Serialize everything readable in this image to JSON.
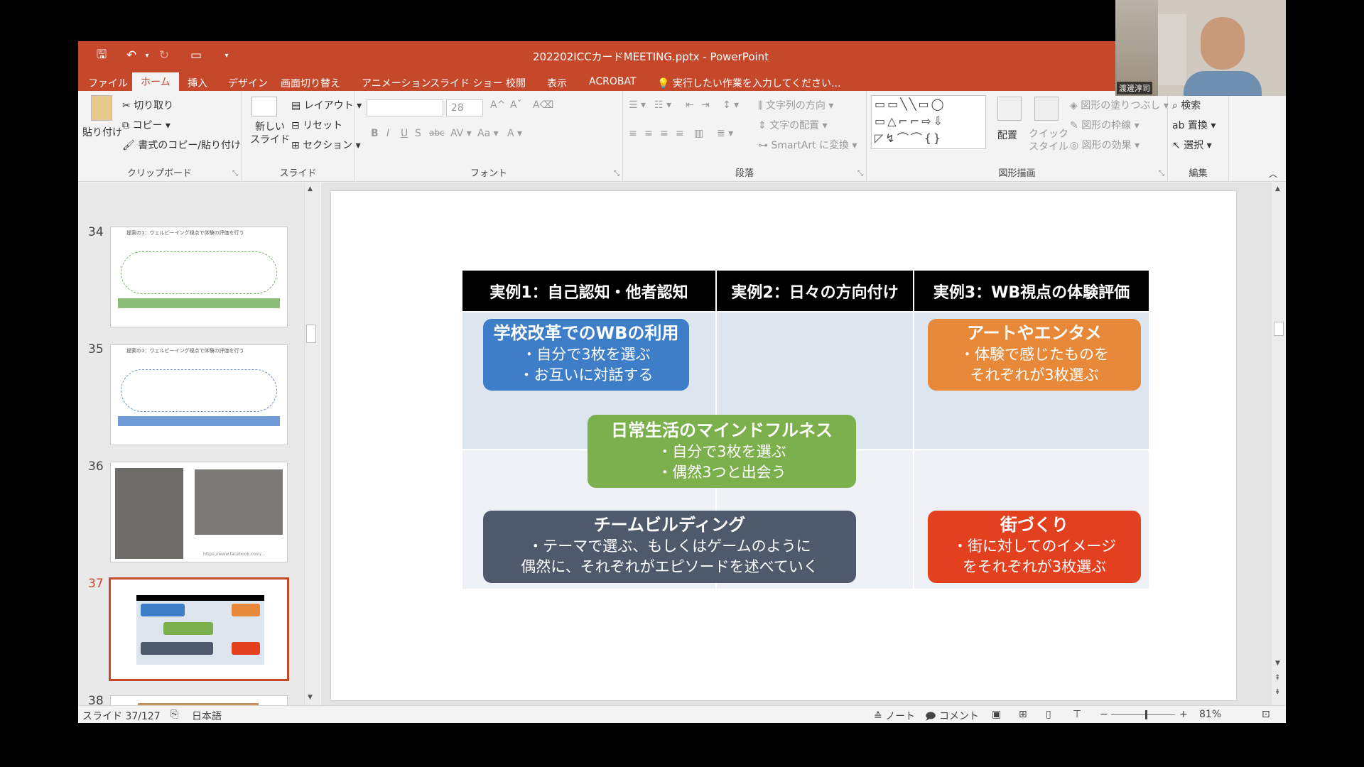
{
  "window": {
    "title": "202202ICCカードMEETING.pptx - PowerPoint"
  },
  "tabs": [
    "ファイル",
    "ホーム",
    "挿入",
    "デザイン",
    "画面切り替え",
    "アニメーション",
    "スライド ショー",
    "校閲",
    "表示",
    "ACROBAT"
  ],
  "tell_me": "実行したい作業を入力してください...",
  "ribbon": {
    "clipboard": {
      "paste": "貼り付け",
      "cut": "切り取り",
      "copy": "コピー",
      "format_painter": "書式のコピー/貼り付け",
      "label": "クリップボード"
    },
    "slides": {
      "new_slide": "新しい\nスライド",
      "layout": "レイアウト",
      "reset": "リセット",
      "section": "セクション",
      "label": "スライド"
    },
    "font": {
      "size": "28",
      "label": "フォント"
    },
    "paragraph": {
      "text_direction": "文字列の方向",
      "align_text": "文字の配置",
      "smartart": "SmartArt に変換",
      "label": "段落"
    },
    "drawing": {
      "arrange": "配置",
      "quick_styles": "クイック\nスタイル",
      "shape_fill": "図形の塗りつぶし",
      "shape_outline": "図形の枠線",
      "shape_effects": "図形の効果",
      "label": "図形描画"
    },
    "editing": {
      "find": "検索",
      "replace": "置換",
      "select": "選択",
      "label": "編集"
    }
  },
  "thumbnails": [
    {
      "num": "34",
      "title": "提案の1：ウェルビーイング視点で体験の評価を行う"
    },
    {
      "num": "35",
      "title": "提案の1：ウェルビーイング視点で体験の評価を行う"
    },
    {
      "num": "36",
      "caption": "https://www.facebook.com/..."
    },
    {
      "num": "37"
    },
    {
      "num": "38"
    }
  ],
  "slide": {
    "headers": [
      "実例1：自己認知・他者認知",
      "実例2：日々の方向付け",
      "実例3：WB視点の体験評価"
    ],
    "cards": {
      "school": {
        "title": "学校改革でのWBの利用",
        "lines": [
          "・自分で3枚を選ぶ",
          "・お互いに対話する"
        ],
        "color": "#3e7dc8"
      },
      "art": {
        "title": "アートやエンタメ",
        "lines": [
          "・体験で感じたものを",
          "それぞれが3枚選ぶ"
        ],
        "color": "#e8893a"
      },
      "mindful": {
        "title": "日常生活のマインドフルネス",
        "lines": [
          "・自分で3枚を選ぶ",
          "・偶然3つと出会う"
        ],
        "color": "#7bb04c"
      },
      "team": {
        "title": "チームビルディング",
        "lines": [
          "・テーマで選ぶ、もしくはゲームのように",
          "偶然に、それぞれがエピソードを述べていく"
        ],
        "color": "#4e5a6c"
      },
      "town": {
        "title": "街づくり",
        "lines": [
          "・街に対してのイメージ",
          "をそれぞれが3枚選ぶ"
        ],
        "color": "#e3401f"
      }
    }
  },
  "status": {
    "slide_counter": "スライド 37/127",
    "language": "日本語",
    "notes": "ノート",
    "comments": "コメント",
    "zoom": "81%"
  },
  "webcam": {
    "name": "渡邊淳司"
  },
  "colors": {
    "accent": "#c5482b",
    "header_bg": "#000000",
    "cell_bg": "#dde5ef"
  }
}
